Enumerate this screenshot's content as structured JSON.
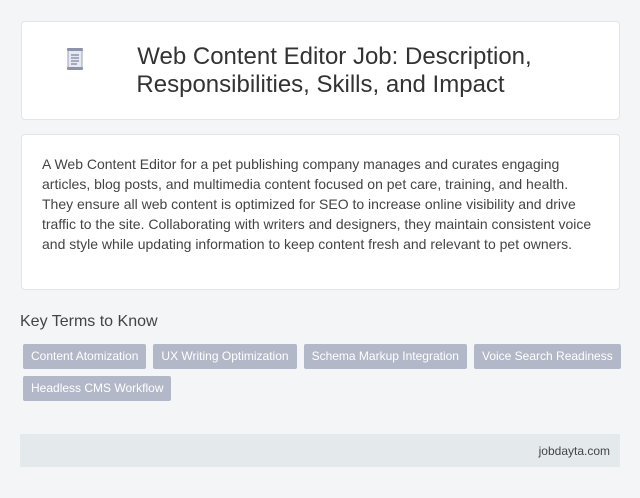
{
  "header": {
    "title_line1": "Web Content Editor Job: Description,",
    "title_line2": "Responsibilities, Skills, and Impact",
    "icon": "document-icon"
  },
  "description": {
    "text": "A Web Content Editor for a pet publishing company manages and curates engaging articles, blog posts, and multimedia content focused on pet care, training, and health. They ensure all web content is optimized for SEO to increase online visibility and drive traffic to the site. Collaborating with writers and designers, they maintain consistent voice and style while updating information to keep content fresh and relevant to pet owners."
  },
  "key_terms": {
    "heading": "Key Terms to Know",
    "tags": [
      "Content Atomization",
      "UX Writing Optimization",
      "Schema Markup Integration",
      "Voice Search Readiness",
      "Headless CMS Workflow"
    ]
  },
  "footer": {
    "site": "jobdayta.com"
  },
  "colors": {
    "tag_bg": "#b3b8c8",
    "footer_bg": "#e4e9ec",
    "page_bg": "#f3f5f6"
  }
}
